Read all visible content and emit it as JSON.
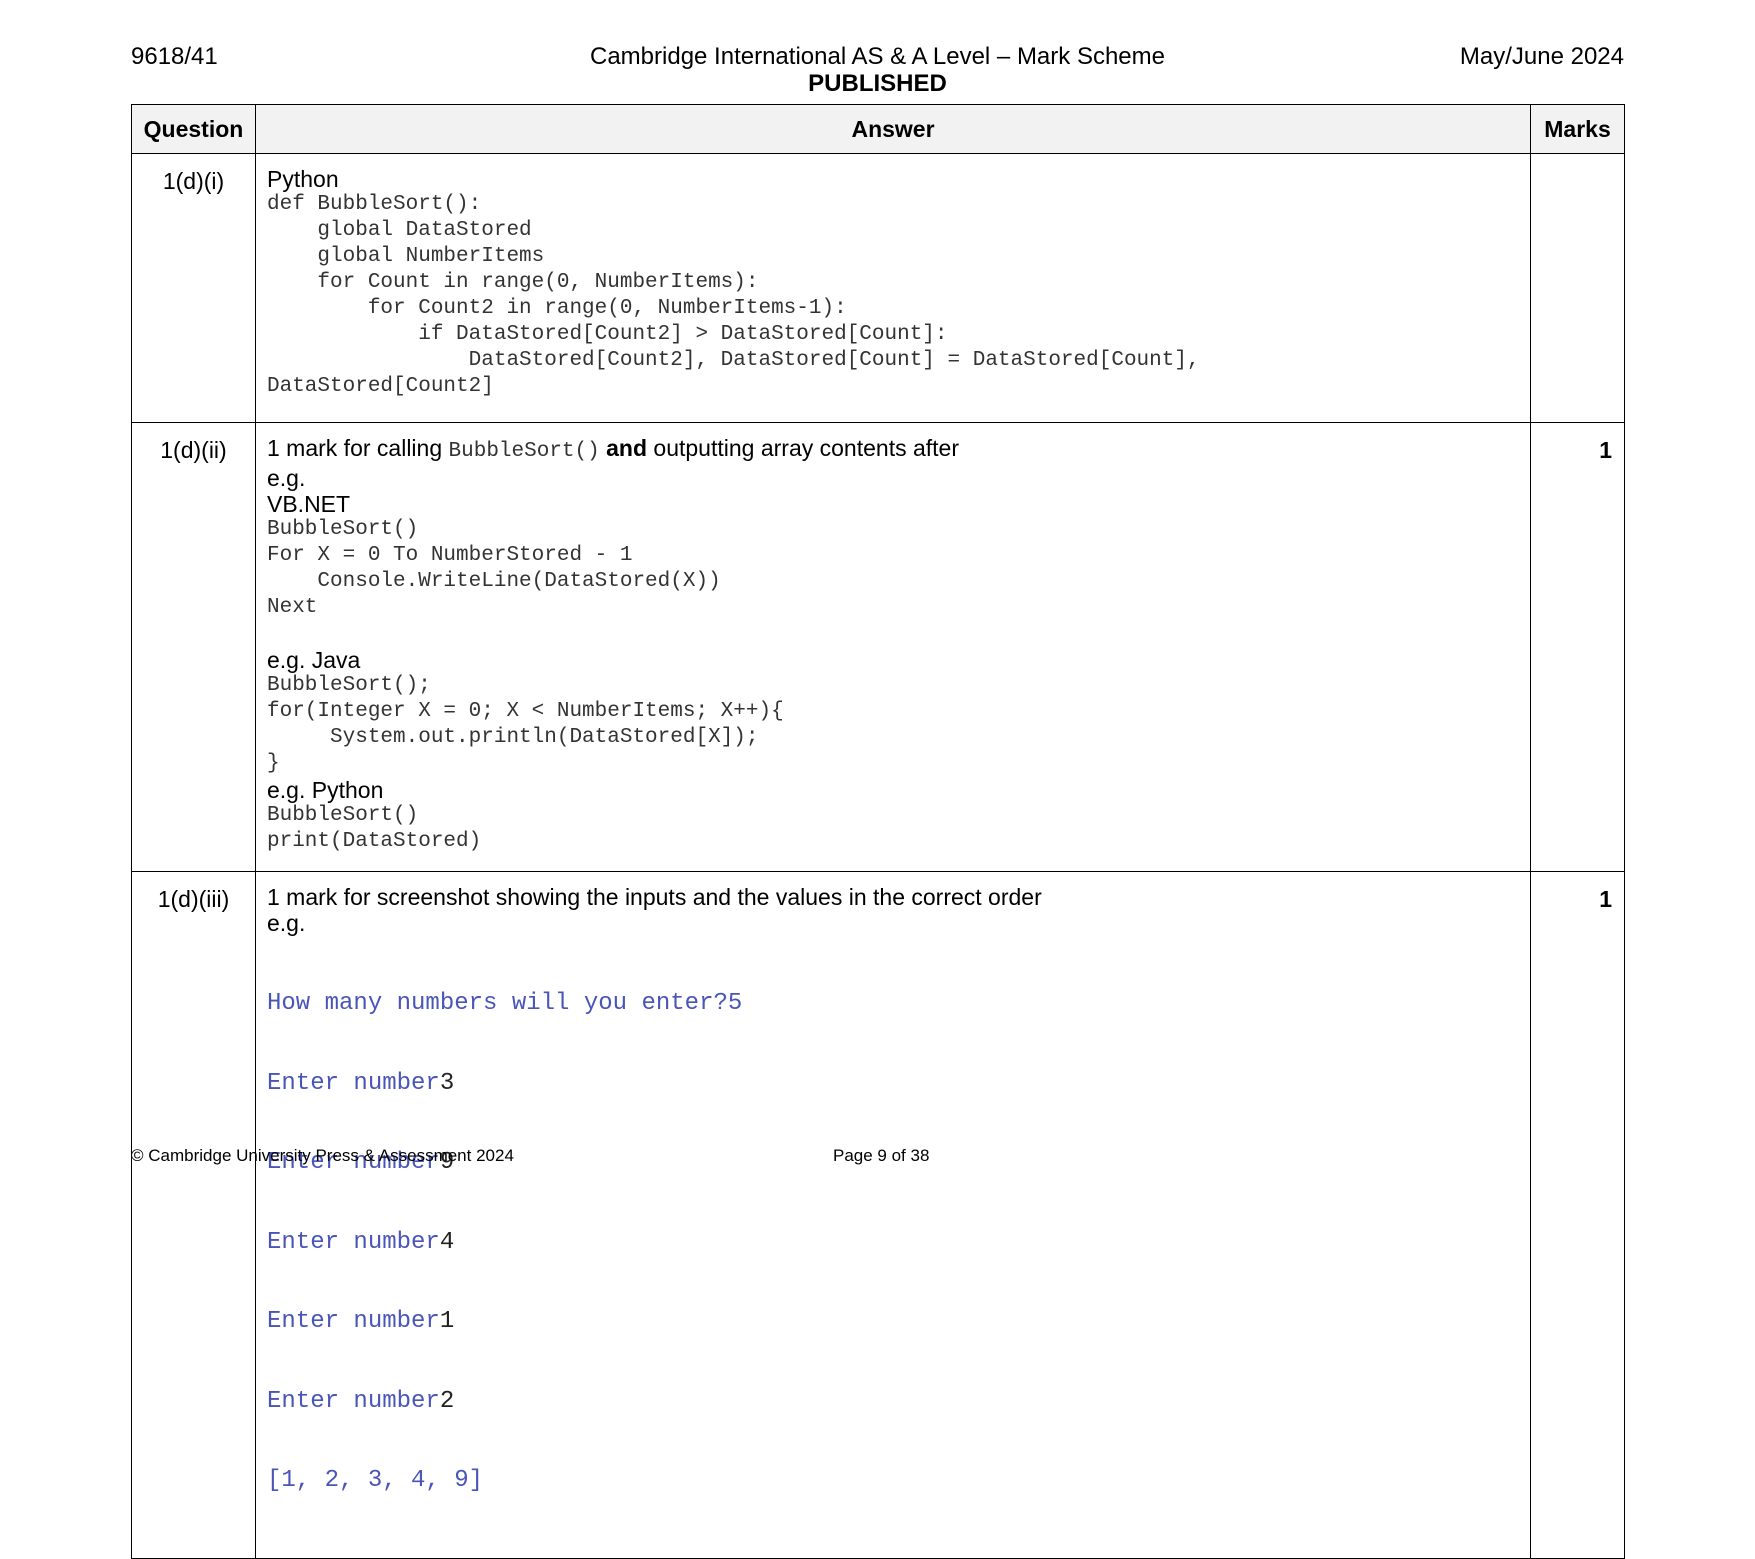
{
  "header": {
    "code": "9618/41",
    "title": "Cambridge International AS & A Level – Mark Scheme",
    "subtitle": "PUBLISHED",
    "session": "May/June 2024"
  },
  "table": {
    "columns": {
      "question": "Question",
      "answer": "Answer",
      "marks": "Marks"
    },
    "rows": [
      {
        "question": "1(d)(i)",
        "marks": "",
        "language": "Python",
        "code": "def BubbleSort():\n    global DataStored\n    global NumberItems\n    for Count in range(0, NumberItems):\n        for Count2 in range(0, NumberItems-1):\n            if DataStored[Count2] > DataStored[Count]:\n                DataStored[Count2], DataStored[Count] = DataStored[Count],\nDataStored[Count2]"
      },
      {
        "question": "1(d)(ii)",
        "marks": "1",
        "criterion_prefix": "1 mark for calling ",
        "criterion_code": "BubbleSort()",
        "criterion_bold": "and",
        "criterion_suffix": " outputting array contents after",
        "eg": "e.g.",
        "vb_label": "VB.NET",
        "vb_code": "BubbleSort()\nFor X = 0 To NumberStored - 1\n    Console.WriteLine(DataStored(X))\nNext",
        "java_label": "e.g. Java",
        "java_code": "BubbleSort();\nfor(Integer X = 0; X < NumberItems; X++){\n     System.out.println(DataStored[X]);\n}",
        "python_label": "e.g. Python",
        "python_code": "BubbleSort()\nprint(DataStored)"
      },
      {
        "question": "1(d)(iii)",
        "marks": "1",
        "criterion": "1 mark for screenshot showing the inputs and the values in the correct order",
        "eg": "e.g.",
        "screenshot": {
          "prompt": "How many numbers will you enter?",
          "count": "5",
          "enter_label": "Enter number",
          "inputs": [
            "3",
            "9",
            "4",
            "1",
            "2"
          ],
          "output": "[1, 2, 3, 4, 9]"
        }
      }
    ]
  },
  "footer": {
    "copyright": "© Cambridge University Press & Assessment 2024",
    "page": "Page 9 of 38"
  },
  "colors": {
    "header_bg": "#f2f2f2",
    "screenshot_text": "#4a55b8",
    "code_text": "#333333"
  }
}
